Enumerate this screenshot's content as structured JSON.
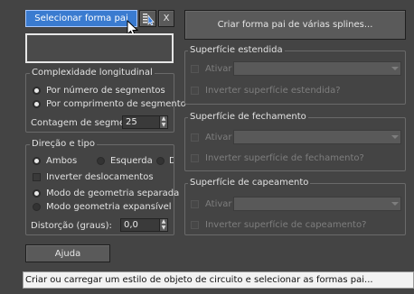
{
  "top": {
    "select_parent_label": "Selecionar forma pai",
    "pick_icon": "pick-cursor-icon",
    "clear_label": "X",
    "create_parent_label": "Criar forma pai de várias splines..."
  },
  "long_complexity": {
    "title": "Complexidade longitudinal",
    "opt_segments": "Por número de segmentos",
    "opt_length": "Por comprimento de segmento",
    "segment_count_label": "Contagem de segme",
    "segment_count_value": "25"
  },
  "direction": {
    "title": "Direção e tipo",
    "both": "Ambos",
    "left": "Esquerda",
    "right": "Direi",
    "invert_offsets": "Inverter deslocamentos",
    "separate_geo": "Modo de geometria separada",
    "expansive_geo": "Modo geometria expansível",
    "distortion_label": "Distorção (graus):",
    "distortion_value": "0,0"
  },
  "help_label": "Ajuda",
  "extended": {
    "title": "Superfície estendida",
    "enable": "Ativar",
    "invert": "Inverter superfície estendida?"
  },
  "closing": {
    "title": "Superfície de fechamento",
    "enable": "Ativar",
    "invert": "Inverter superfície de fechamento?"
  },
  "capping": {
    "title": "Superfície de capeamento",
    "enable": "Ativar",
    "invert": "Inverter superfície de capeamento?"
  },
  "status_text": "Criar ou carregar um estilo de objeto de circuito e selecionar as formas pai..."
}
